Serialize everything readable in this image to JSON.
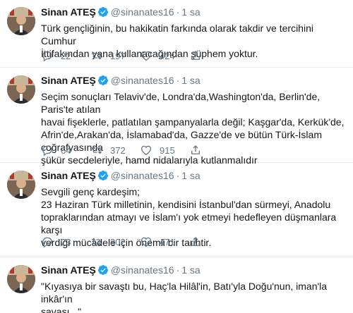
{
  "tweets": [
    {
      "name": "Sinan ATEŞ",
      "handle": "@sinanates16",
      "time": "1 sa",
      "text": "Türk gençliğinin, bu hakikatin farkında olarak takdir ve tercihini Cumhur\nİttifakından yana kullanacağından şüphem yoktur.",
      "replies": "22",
      "retweets": "197",
      "likes": "424"
    },
    {
      "name": "Sinan ATEŞ",
      "handle": "@sinanates16",
      "time": "1 sa",
      "text": "Seçim sonuçları Telaviv'de, Londra'da,Washington'da, Berlin'de, Paris'te atılan\nhavai fişeklerle, patlatılan şampanyalarla değil; Kaşgar'da, Kerkük'de,\nAfrin'de,Arakan'da, İslamabad'da, Gazze'de ve bütün Türk-İslam coğrafyasında\nşükür secdeleriyle, hamd nidalarıyla kutlanmalıdır",
      "replies": "64",
      "retweets": "372",
      "likes": "915"
    },
    {
      "name": "Sinan ATEŞ",
      "handle": "@sinanates16",
      "time": "1 sa",
      "text": "Sevgili genç kardeşim;\n23 Haziran Türk milletinin, kendisini İstanbul'dan sürmeyi, Anadolu\ntopraklarından atmayı ve İslam'ı yok etmeyi hedefleyen düşmanlara karşı\nverdiği mücadele için önemli bir tarihtir.",
      "replies": "23",
      "retweets": "302",
      "likes": "471"
    },
    {
      "name": "Sinan ATEŞ",
      "handle": "@sinanates16",
      "time": "1 sa",
      "text": "\"Kıyasıya bir savaştı bu, Haç'la Hilâl'in, Batı'yla Doğu'nun, iman'la inkâr'ın\nsavaşı...\""
    }
  ],
  "icons": {
    "verified": "verified-badge-icon",
    "reply": "reply-icon",
    "retweet": "retweet-icon",
    "like": "heart-icon",
    "share": "share-icon"
  },
  "colors": {
    "verified": "#1da1f2",
    "secondary_text": "#657786",
    "divider": "#e6ecf0"
  }
}
